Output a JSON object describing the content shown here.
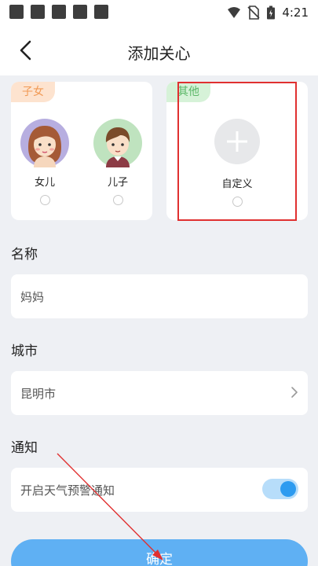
{
  "status_bar": {
    "time": "4:21"
  },
  "header": {
    "title": "添加关心"
  },
  "cards": {
    "family": {
      "tag": "子女",
      "options": [
        {
          "label": "女儿",
          "avatar": "daughter-avatar"
        },
        {
          "label": "儿子",
          "avatar": "son-avatar"
        }
      ]
    },
    "other": {
      "tag": "其他",
      "options": [
        {
          "label": "自定义",
          "icon": "plus-icon"
        }
      ]
    }
  },
  "name_section": {
    "label": "名称",
    "value": "妈妈"
  },
  "city_section": {
    "label": "城市",
    "value": "昆明市"
  },
  "notify_section": {
    "label": "通知",
    "toggle_label": "开启天气预警通知",
    "toggle_on": true
  },
  "confirm": {
    "label": "确定"
  },
  "colors": {
    "accent": "#2d9bf0",
    "button": "#5fb0f3",
    "tag_orange": "#f19a55",
    "tag_green": "#5bb767",
    "annotation_red": "#e03030"
  }
}
